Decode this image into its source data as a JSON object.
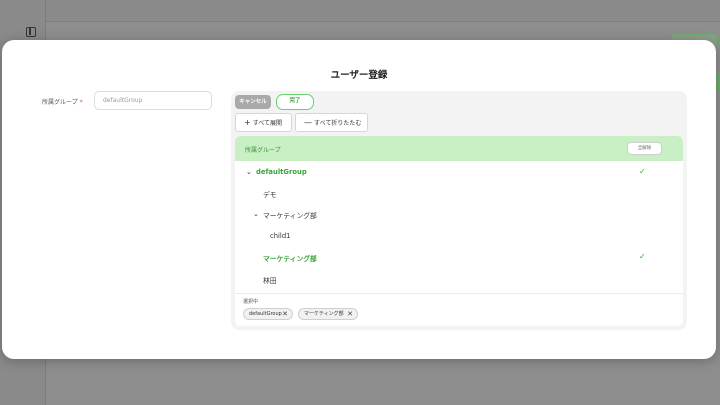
{
  "background": {
    "page_title": "ユーザー登録"
  },
  "modal": {
    "title": "ユーザー登録",
    "group_field": {
      "label": "所属グループ",
      "required_mark": "*",
      "value": "defaultGroup"
    },
    "toolbar": {
      "cancel_label": "キャンセル",
      "done_label": "完了",
      "expand_all_label": "すべて展開",
      "collapse_all_label": "すべて折りたたむ",
      "expand_symbol": "+",
      "collapse_symbol": "—"
    },
    "list": {
      "header_label": "所属グループ",
      "clear_all_label": "全解除",
      "items": [
        {
          "label": "defaultGroup",
          "level": 0,
          "expandable": true,
          "selected": true
        },
        {
          "label": "デモ",
          "level": 1,
          "expandable": false,
          "selected": false
        },
        {
          "label": "マーケティング部",
          "level": 1,
          "expandable": true,
          "selected": false
        },
        {
          "label": "child1",
          "level": 2,
          "expandable": false,
          "selected": false
        },
        {
          "label": "マーケティング部",
          "level": 1,
          "expandable": false,
          "selected": true
        },
        {
          "label": "林田",
          "level": 1,
          "expandable": false,
          "selected": false
        }
      ]
    },
    "selection": {
      "title": "選択中",
      "chips": [
        "defaultGroup",
        "マーケティング部"
      ]
    }
  },
  "colors": {
    "accent": "#3aa33a",
    "header_bg": "#c9efc4",
    "required": "#e05050"
  },
  "icons": {
    "check": "check-icon",
    "chevron": "chevron-down-icon",
    "remove": "close-icon",
    "sidebar_toggle": "sidebar-toggle-icon"
  }
}
